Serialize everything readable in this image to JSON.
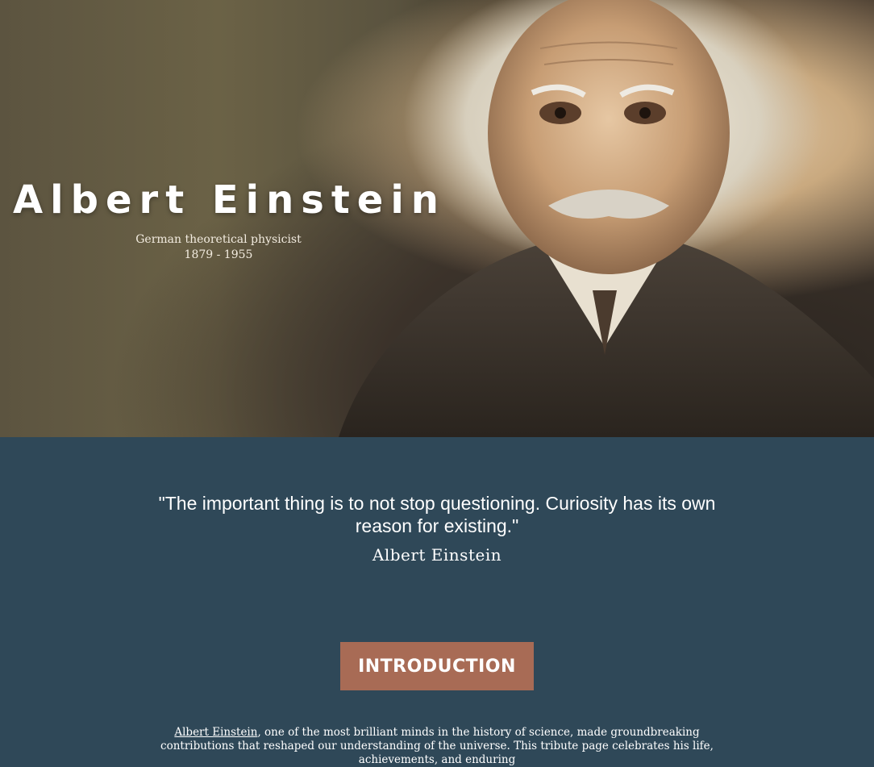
{
  "hero": {
    "title": "Albert Einstein",
    "subtitle": "German theoretical physicist",
    "years": "1879 - 1955"
  },
  "quote": {
    "text": "\"The important thing is to not stop questioning. Curiosity has its own reason for existing.\"",
    "author": "Albert Einstein"
  },
  "introduction": {
    "button_label": "INTRODUCTION",
    "link_text": "Albert Einstein",
    "body": ", one of the most brilliant minds in the history of science, made groundbreaking contributions that reshaped our understanding of the universe. This tribute page celebrates his life, achievements, and enduring"
  },
  "colors": {
    "section_bg": "#2f4858",
    "button_bg": "#a86b55"
  }
}
